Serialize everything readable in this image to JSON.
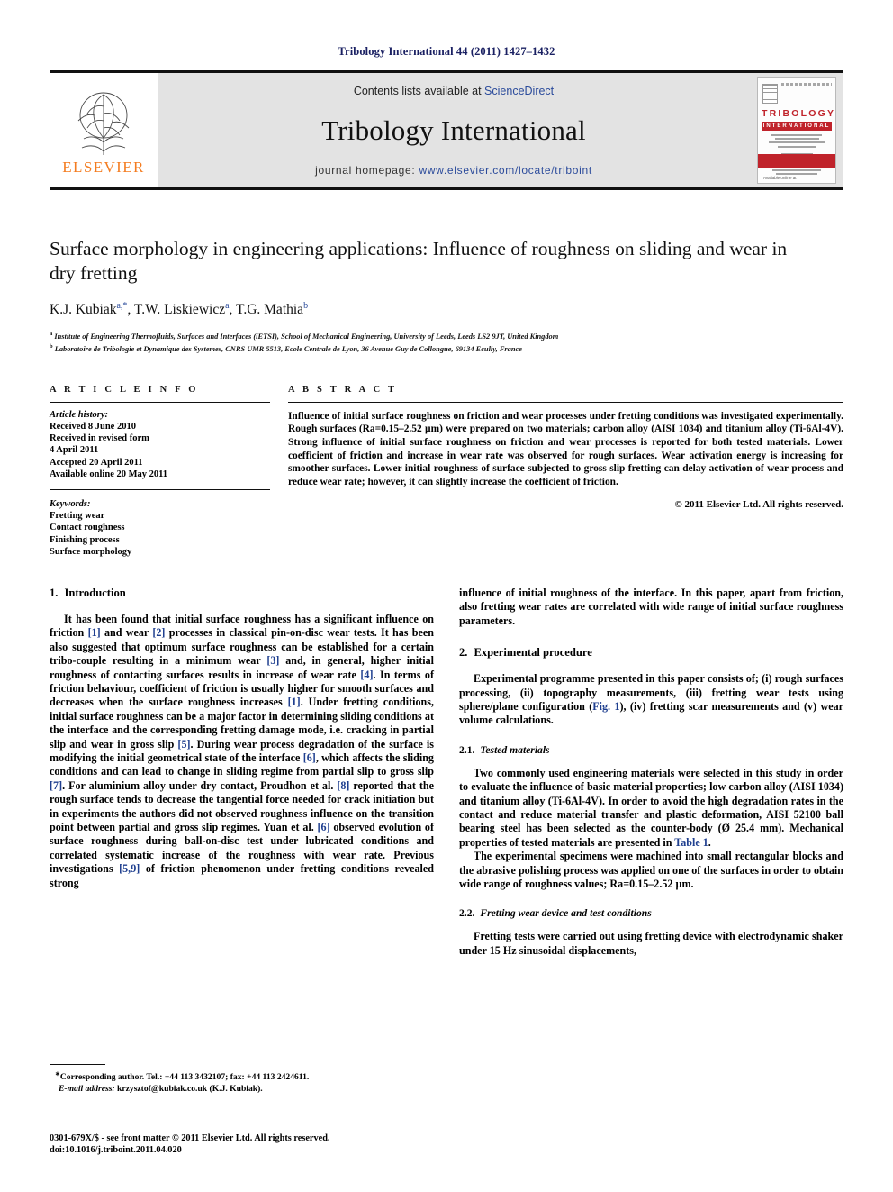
{
  "running_head": "Tribology International 44 (2011) 1427–1432",
  "masthead": {
    "contents_prefix": "Contents lists available at ",
    "contents_link": "ScienceDirect",
    "journal_title": "Tribology International",
    "homepage_prefix": "journal homepage: ",
    "homepage_link": "www.elsevier.com/locate/triboint",
    "publisher_name": "ELSEVIER",
    "cover": {
      "title_main": "TRIBOLOGY",
      "title_sub": "INTERNATIONAL",
      "footer_text": "Available online at"
    }
  },
  "article": {
    "title": "Surface morphology in engineering applications: Influence of roughness on sliding and wear in dry fretting",
    "authors": [
      {
        "name": "K.J. Kubiak",
        "marks": "a,*"
      },
      {
        "name": "T.W. Liskiewicz",
        "marks": "a"
      },
      {
        "name": "T.G. Mathia",
        "marks": "b"
      }
    ],
    "affiliations": [
      {
        "mark": "a",
        "text": "Institute of Engineering Thermofluids, Surfaces and Interfaces (iETSI), School of Mechanical Engineering, University of Leeds, Leeds LS2 9JT, United Kingdom"
      },
      {
        "mark": "b",
        "text": "Laboratoire de Tribologie et Dynamique des Systemes, CNRS UMR 5513, Ecole Centrale de Lyon, 36 Avenue Guy de Collongue, 69134 Ecully, France"
      }
    ]
  },
  "article_info": {
    "heading": "A R T I C L E   I N F O",
    "history_label": "Article history:",
    "history": [
      "Received 8 June 2010",
      "Received in revised form",
      "4 April 2011",
      "Accepted 20 April 2011",
      "Available online 20 May 2011"
    ],
    "keywords_label": "Keywords:",
    "keywords": [
      "Fretting wear",
      "Contact roughness",
      "Finishing process",
      "Surface morphology"
    ]
  },
  "abstract": {
    "heading": "A B S T R A C T",
    "text": "Influence of initial surface roughness on friction and wear processes under fretting conditions was investigated experimentally. Rough surfaces (Ra=0.15–2.52 µm) were prepared on two materials; carbon alloy (AISI 1034) and titanium alloy (Ti-6Al-4V). Strong influence of initial surface roughness on friction and wear processes is reported for both tested materials. Lower coefficient of friction and increase in wear rate was observed for rough surfaces. Wear activation energy is increasing for smoother surfaces. Lower initial roughness of surface subjected to gross slip fretting can delay activation of wear process and reduce wear rate; however, it can slightly increase the coefficient of friction.",
    "copyright": "© 2011 Elsevier Ltd. All rights reserved."
  },
  "sections": {
    "introduction": {
      "number": "1.",
      "heading": "Introduction",
      "p1_a": "It has been found that initial surface roughness has a significant influence on friction ",
      "p1_r1": "[1]",
      "p1_b": " and wear ",
      "p1_r2": "[2]",
      "p1_c": " processes in classical pin-on-disc wear tests. It has been also suggested that optimum surface roughness can be established for a certain tribo-couple resulting in a minimum wear ",
      "p1_r3": "[3]",
      "p1_d": " and, in general, higher initial roughness of contacting surfaces results in increase of wear rate ",
      "p1_r4": "[4]",
      "p1_e": ". In terms of friction behaviour, coefficient of friction is usually higher for smooth surfaces and decreases when the surface roughness increases ",
      "p1_r5": "[1]",
      "p1_f": ". Under fretting conditions, initial surface roughness can be a major factor in determining sliding conditions at the interface and the corresponding fretting damage mode, i.e. cracking in partial slip and wear in gross slip ",
      "p1_r6": "[5]",
      "p1_g": ". During wear process degradation of the surface is modifying the initial geometrical state of the interface ",
      "p1_r7": "[6]",
      "p1_h": ", which affects the sliding conditions and can lead to change in sliding regime from partial slip to gross slip ",
      "p1_r8": "[7]",
      "p1_i": ". For aluminium alloy under dry contact, Proudhon et al. ",
      "p1_r9": "[8]",
      "p1_j": " reported that the rough surface tends to decrease the tangential force needed for crack initiation but in experiments the authors did not observed roughness influence on the transition point between partial and gross slip regimes. Yuan et al. ",
      "p1_r10": "[6]",
      "p1_k": " observed evolution of surface roughness during ball-on-disc test under lubricated conditions and correlated systematic increase of the roughness with wear rate. Previous investigations ",
      "p1_r11": "[5,9]",
      "p1_l": " of friction phenomenon under fretting conditions revealed strong influence of initial roughness of the interface. In this paper, apart from friction, also fretting wear rates are correlated with wide range of initial surface roughness parameters."
    },
    "experimental": {
      "number": "2.",
      "heading": "Experimental procedure",
      "p1_a": "Experimental programme presented in this paper consists of; (i) rough surfaces processing, (ii) topography measurements, (iii) fretting wear tests using sphere/plane configuration (",
      "p1_link": "Fig. 1",
      "p1_b": "), (iv) fretting scar measurements and (v) wear volume calculations.",
      "sub1": {
        "number": "2.1.",
        "heading": "Tested materials",
        "p1_a": "Two commonly used engineering materials were selected in this study in order to evaluate the influence of basic material properties; low carbon alloy (AISI 1034) and titanium alloy (Ti-6Al-4V). In order to avoid the high degradation rates in the contact and reduce material transfer and plastic deformation, AISI 52100 ball bearing steel has been selected as the counter-body (Ø 25.4 mm). Mechanical properties of tested materials are presented in ",
        "p1_link": "Table 1",
        "p1_b": ".",
        "p2": "The experimental specimens were machined into small rectangular blocks and the abrasive polishing process was applied on one of the surfaces in order to obtain wide range of roughness values; Ra=0.15–2.52 µm."
      },
      "sub2": {
        "number": "2.2.",
        "heading": "Fretting wear device and test conditions",
        "p1": "Fretting tests were carried out using fretting device with electrodynamic shaker under 15 Hz sinusoidal displacements,"
      }
    }
  },
  "footnote": {
    "corresponding": "Corresponding author. Tel.: +44 113 3432107; fax: +44 113 2424611.",
    "email_label": "E-mail address:",
    "email": " krzysztof@kubiak.co.uk (K.J. Kubiak)."
  },
  "footer": {
    "line1": "0301-679X/$ - see front matter © 2011 Elsevier Ltd. All rights reserved.",
    "line2": "doi:10.1016/j.triboint.2011.04.020"
  },
  "colors": {
    "link": "#1f3f8f",
    "runhead": "#1a2062",
    "elsevier_orange": "#f47c20",
    "cover_red": "#c0232b",
    "mast_grey": "#e3e3e3"
  }
}
